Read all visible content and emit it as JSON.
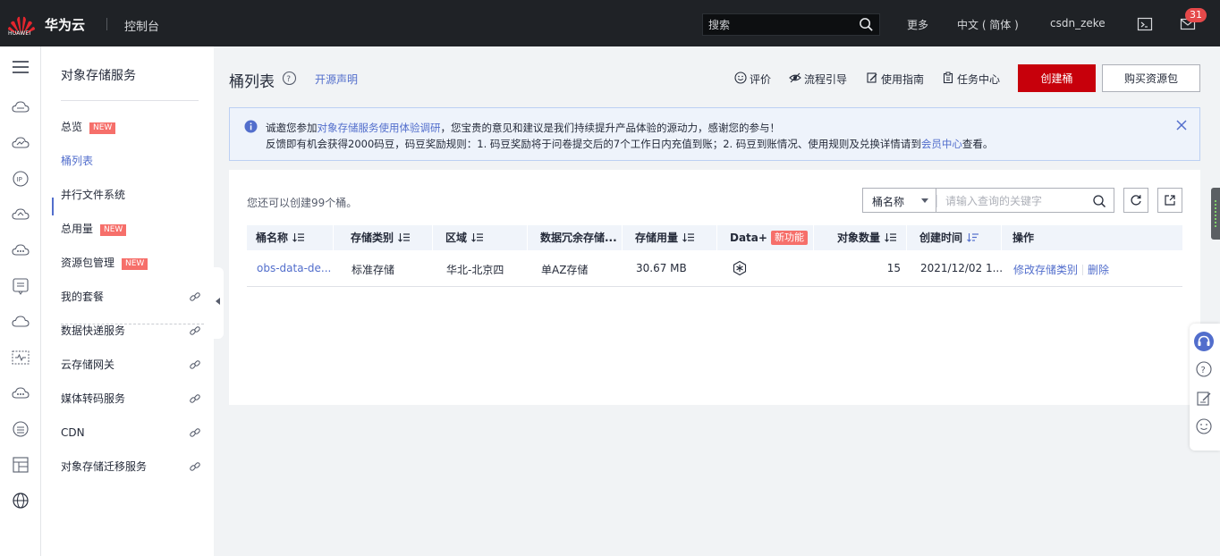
{
  "topbar": {
    "logo_text": "HUAWEI",
    "brand": "华为云",
    "console": "控制台",
    "search_placeholder": "搜索",
    "more": "更多",
    "language": "中文 ( 简体 )",
    "username": "csdn_zeke",
    "notification_count": "31"
  },
  "sidebar": {
    "service_title": "对象存储服务",
    "items": [
      {
        "label": "总览",
        "badge": "NEW"
      },
      {
        "label": "桶列表"
      },
      {
        "label": "并行文件系统"
      },
      {
        "label": "总用量",
        "badge": "NEW"
      },
      {
        "label": "资源包管理",
        "badge": "NEW"
      },
      {
        "label": "我的套餐"
      },
      {
        "label": "数据快递服务"
      },
      {
        "label": "云存储网关"
      },
      {
        "label": "媒体转码服务"
      },
      {
        "label": "CDN"
      },
      {
        "label": "对象存储迁移服务"
      }
    ]
  },
  "header": {
    "title": "桶列表",
    "open_source": "开源声明",
    "rate": "评价",
    "guide": "流程引导",
    "manual": "使用指南",
    "tasks": "任务中心",
    "create_button": "创建桶",
    "buy_button": "购买资源包"
  },
  "notice": {
    "l1_a": "诚邀您参加",
    "l1_link": "对象存储服务使用体验调研",
    "l1_b": "，您宝贵的意见和建议是我们持续提升产品体验的源动力，感谢您的参与！",
    "l2_a": "反馈即有机会获得2000码豆，码豆奖励规则：1. 码豆奖励将于问卷提交后的7个工作日内充值到账；2. 码豆到账情况、使用规则及兑换详情请到",
    "l2_link": "会员中心",
    "l2_b": "查看。"
  },
  "panel": {
    "quota_text": "您还可以创建99个桶。",
    "filter_field": "桶名称",
    "filter_placeholder": "请输入查询的关键字"
  },
  "table": {
    "headers": {
      "name": "桶名称",
      "storage_class": "存储类别",
      "region": "区域",
      "redundancy": "数据冗余存储...",
      "usage": "存储用量",
      "data_plus": "Data+",
      "data_plus_badge": "新功能",
      "objects": "对象数量",
      "created": "创建时间",
      "ops": "操作"
    },
    "rows": [
      {
        "name": "obs-data-de...",
        "storage_class": "标准存储",
        "region": "华北-北京四",
        "redundancy": "单AZ存储",
        "usage": "30.67 MB",
        "objects": "15",
        "created": "2021/12/02 1...",
        "op_modify": "修改存储类别",
        "op_delete": "删除"
      }
    ]
  },
  "colors": {
    "topbar": "#1f2226",
    "brand_red": "#c7000b",
    "link": "#526ecc",
    "new_badge": "#f66f6a",
    "notice_bg": "#eef3fb"
  }
}
